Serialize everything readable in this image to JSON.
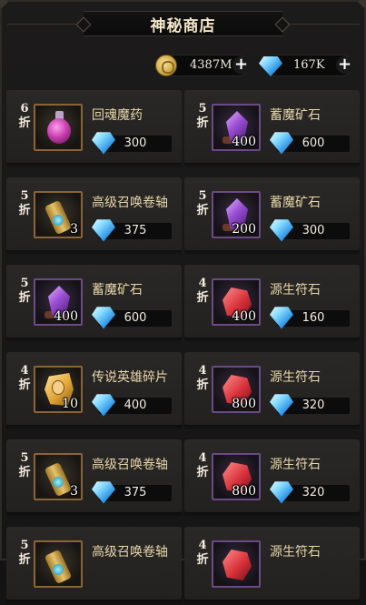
{
  "header": {
    "title": "神秘商店"
  },
  "currencies": [
    {
      "name": "gold",
      "value": "4387M"
    },
    {
      "name": "diamond",
      "value": "167K"
    }
  ],
  "items": [
    {
      "discount": "6\n折",
      "name": "回魂魔药",
      "qty": "",
      "price": "300",
      "art": "potion",
      "frame": "orange"
    },
    {
      "discount": "5\n折",
      "name": "蓄魔矿石",
      "qty": "400",
      "price": "600",
      "art": "crystal",
      "frame": "purple"
    },
    {
      "discount": "5\n折",
      "name": "高级召唤卷轴",
      "qty": "3",
      "price": "375",
      "art": "scroll",
      "frame": "orange"
    },
    {
      "discount": "5\n折",
      "name": "蓄魔矿石",
      "qty": "200",
      "price": "300",
      "art": "crystal",
      "frame": "purple"
    },
    {
      "discount": "5\n折",
      "name": "蓄魔矿石",
      "qty": "400",
      "price": "600",
      "art": "crystal",
      "frame": "purple"
    },
    {
      "discount": "4\n折",
      "name": "源生符石",
      "qty": "400",
      "price": "160",
      "art": "rune",
      "frame": "purple"
    },
    {
      "discount": "4\n折",
      "name": "传说英雄碎片",
      "qty": "10",
      "price": "400",
      "art": "hero",
      "frame": "orange"
    },
    {
      "discount": "4\n折",
      "name": "源生符石",
      "qty": "800",
      "price": "320",
      "art": "rune",
      "frame": "purple"
    },
    {
      "discount": "5\n折",
      "name": "高级召唤卷轴",
      "qty": "3",
      "price": "375",
      "art": "scroll",
      "frame": "orange"
    },
    {
      "discount": "4\n折",
      "name": "源生符石",
      "qty": "800",
      "price": "320",
      "art": "rune",
      "frame": "purple"
    },
    {
      "discount": "5\n折",
      "name": "高级召唤卷轴",
      "qty": "",
      "price": "",
      "art": "scroll",
      "frame": "orange"
    },
    {
      "discount": "4\n折",
      "name": "源生符石",
      "qty": "",
      "price": "",
      "art": "rune",
      "frame": "purple"
    }
  ]
}
